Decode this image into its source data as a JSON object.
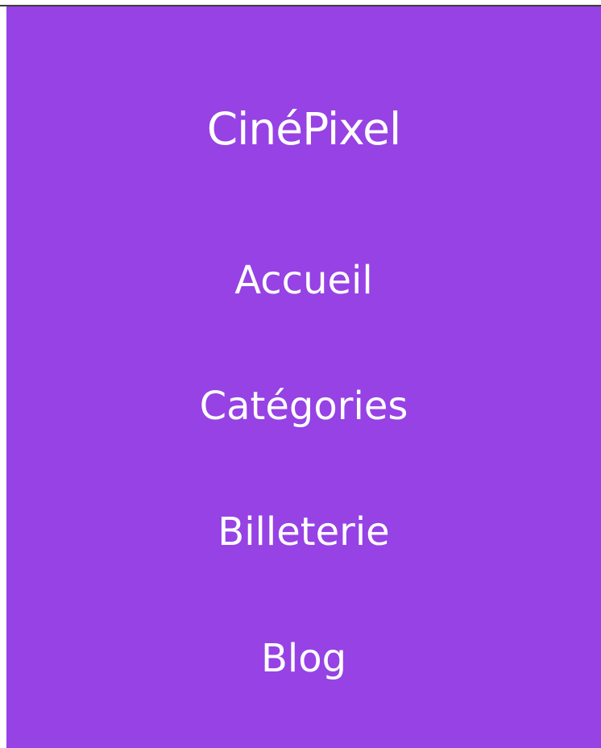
{
  "theme": {
    "panel_color": "#9642e4",
    "text_color": "#ffffff"
  },
  "brand": {
    "title": "CinéPixel"
  },
  "menu": {
    "items": [
      {
        "label": "Accueil"
      },
      {
        "label": "Catégories"
      },
      {
        "label": "Billeterie"
      },
      {
        "label": "Blog"
      }
    ]
  }
}
